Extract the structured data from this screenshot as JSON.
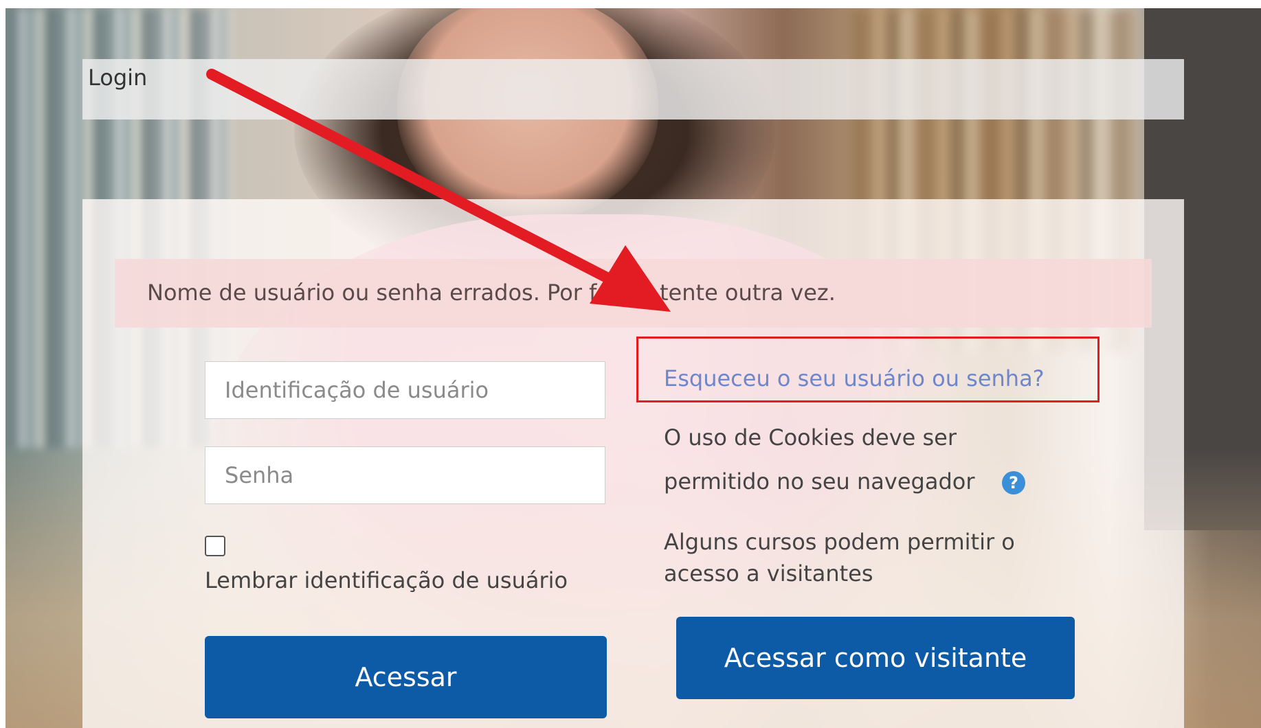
{
  "header": {
    "title": "Login"
  },
  "alert": {
    "message": "Nome de usuário ou senha errados. Por favor, tente outra vez."
  },
  "form": {
    "username_placeholder": "Identificação de usuário",
    "username_value": "",
    "password_placeholder": "Senha",
    "password_value": "",
    "remember_label": "Lembrar identificação de usuário",
    "remember_checked": false,
    "login_button": "Acessar"
  },
  "side": {
    "forgot_link": "Esqueceu o seu usuário ou senha?",
    "cookies_line1": "O uso de Cookies deve ser",
    "cookies_line2": "permitido no seu navegador",
    "help_icon": "question-circle-icon",
    "guest_line1": "Alguns cursos podem permitir o",
    "guest_line2": "acesso a visitantes",
    "guest_button": "Acessar como visitante"
  },
  "colors": {
    "primary_button": "#0d5aa7",
    "link": "#6f86c9",
    "alert_bg": "#f6d8d8",
    "annotation": "#e31b23",
    "help_icon": "#3b8fd9"
  },
  "annotations": {
    "arrow_icon": "red-arrow-icon",
    "highlight": "red-rectangle-highlight"
  }
}
